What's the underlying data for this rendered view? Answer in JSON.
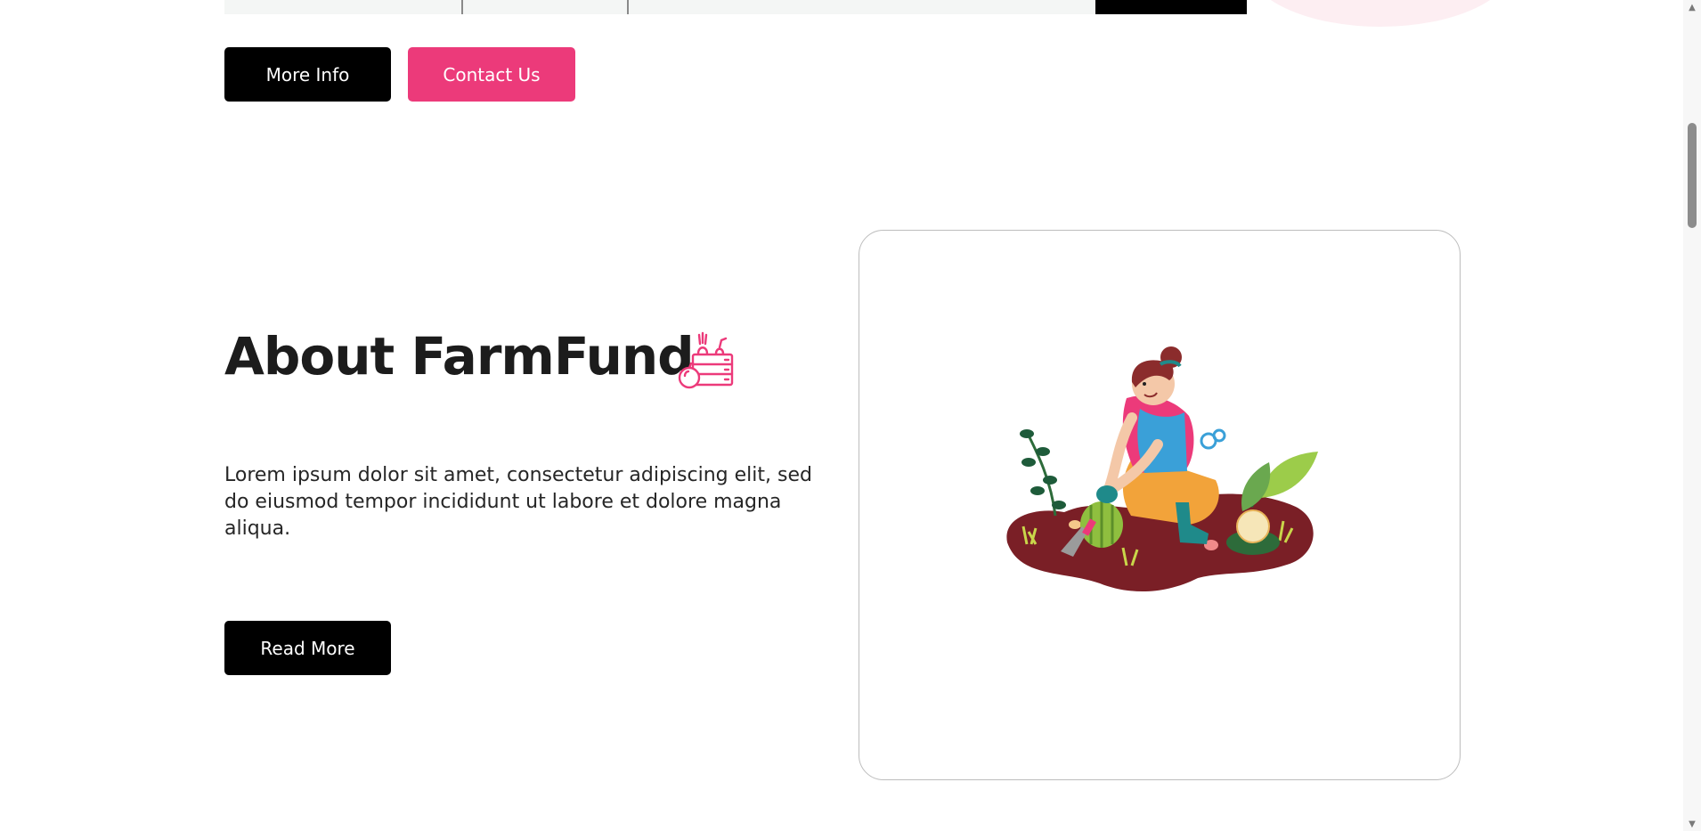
{
  "hero": {
    "more_info_label": "More Info",
    "contact_label": "Contact Us"
  },
  "about": {
    "title": "About FarmFund",
    "title_icon": "farm-crate-icon",
    "body": "Lorem ipsum dolor sit amet, consectetur adipiscing elit, sed do eiusmod tempor incididunt ut labore et dolore magna aliqua.",
    "read_more_label": "Read More",
    "image": "woman-gardening-illustration"
  },
  "colors": {
    "accent": "#ec3a7a",
    "dark_button": "#000000",
    "text": "#1c1c1c"
  }
}
